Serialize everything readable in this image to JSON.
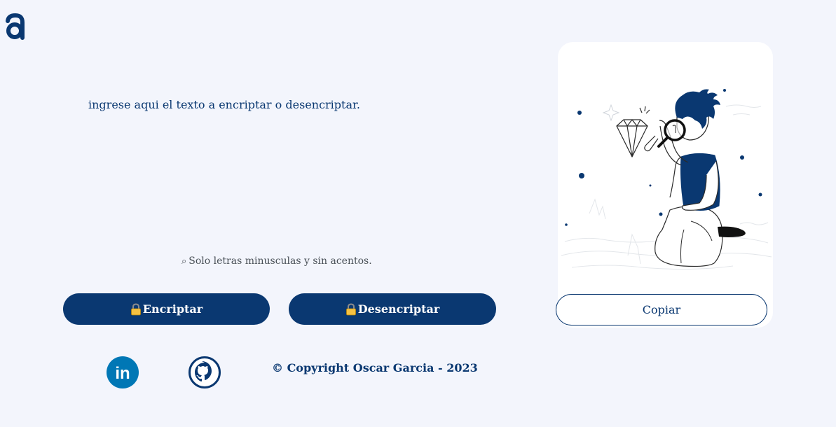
{
  "brand": {
    "logo_letter": "a",
    "accent_color": "#0a3871"
  },
  "editor": {
    "placeholder": "ingrese aqui el texto a encriptar o desencriptar."
  },
  "hint": {
    "icon": "search-icon",
    "icon_glyph": "⌕",
    "text": "Solo letras minusculas y sin acentos."
  },
  "actions": {
    "encrypt_icon": "lock-icon",
    "encrypt_label": "Encriptar",
    "decrypt_icon": "lock-icon",
    "decrypt_label": "Desencriptar",
    "copy_label": "Copiar"
  },
  "output": {
    "illustration": "person-with-magnifying-glass-and-diamond"
  },
  "footer": {
    "social": [
      {
        "name": "linkedin",
        "icon": "linkedin-icon",
        "glyph": "in"
      },
      {
        "name": "github",
        "icon": "github-icon"
      }
    ],
    "copyright": "© Copyright Oscar Garcia - 2023"
  }
}
